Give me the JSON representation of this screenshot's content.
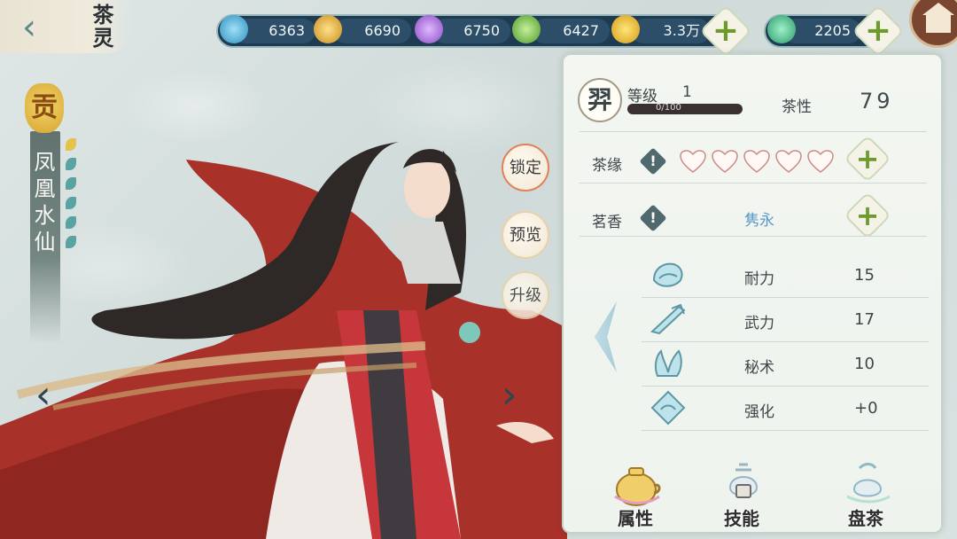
{
  "header": {
    "title": "茶灵",
    "back_icon": "back-arrow-icon"
  },
  "currencies": [
    {
      "name": "blue-orb",
      "value": "6363",
      "color": "#57b6e0"
    },
    {
      "name": "gold-orb",
      "value": "6690",
      "color": "#e6b53b"
    },
    {
      "name": "purple-orb",
      "value": "6750",
      "color": "#b47de0"
    },
    {
      "name": "green-orb",
      "value": "6427",
      "color": "#76c24b"
    },
    {
      "name": "coin",
      "value": "3.3万",
      "color": "#f0c03a"
    }
  ],
  "gems": {
    "value": "2205",
    "color": "#4cc78f"
  },
  "character": {
    "rank": "贡",
    "name": "凤凰水仙",
    "grade": "羿",
    "level_label": "等级",
    "level": "1",
    "exp": "0/100",
    "tea_nature_label": "茶性",
    "tea_nature": "79"
  },
  "side_buttons": {
    "lock": "锁定",
    "preview": "预览",
    "upgrade": "升级"
  },
  "fate": {
    "label": "茶缘",
    "hearts_total": 5,
    "hearts_filled": 0
  },
  "aroma": {
    "label": "茗香",
    "value": "隽永"
  },
  "stats": [
    {
      "label": "耐力",
      "value": "15",
      "icon": "endurance-icon"
    },
    {
      "label": "武力",
      "value": "17",
      "icon": "force-icon"
    },
    {
      "label": "秘术",
      "value": "10",
      "icon": "arcane-icon"
    },
    {
      "label": "强化",
      "value": "+0",
      "icon": "enhance-icon"
    }
  ],
  "tabs": [
    {
      "label": "属性",
      "icon": "teapot-icon",
      "locked": false
    },
    {
      "label": "技能",
      "icon": "skill-icon",
      "locked": true
    },
    {
      "label": "盘茶",
      "icon": "tea-cup-icon",
      "locked": false
    }
  ],
  "colors": {
    "accent_green": "#6c9a2c",
    "panel_bg": "#f3f6f1",
    "currency_bar": "#1f3b52",
    "robe_red": "#a8322a"
  }
}
